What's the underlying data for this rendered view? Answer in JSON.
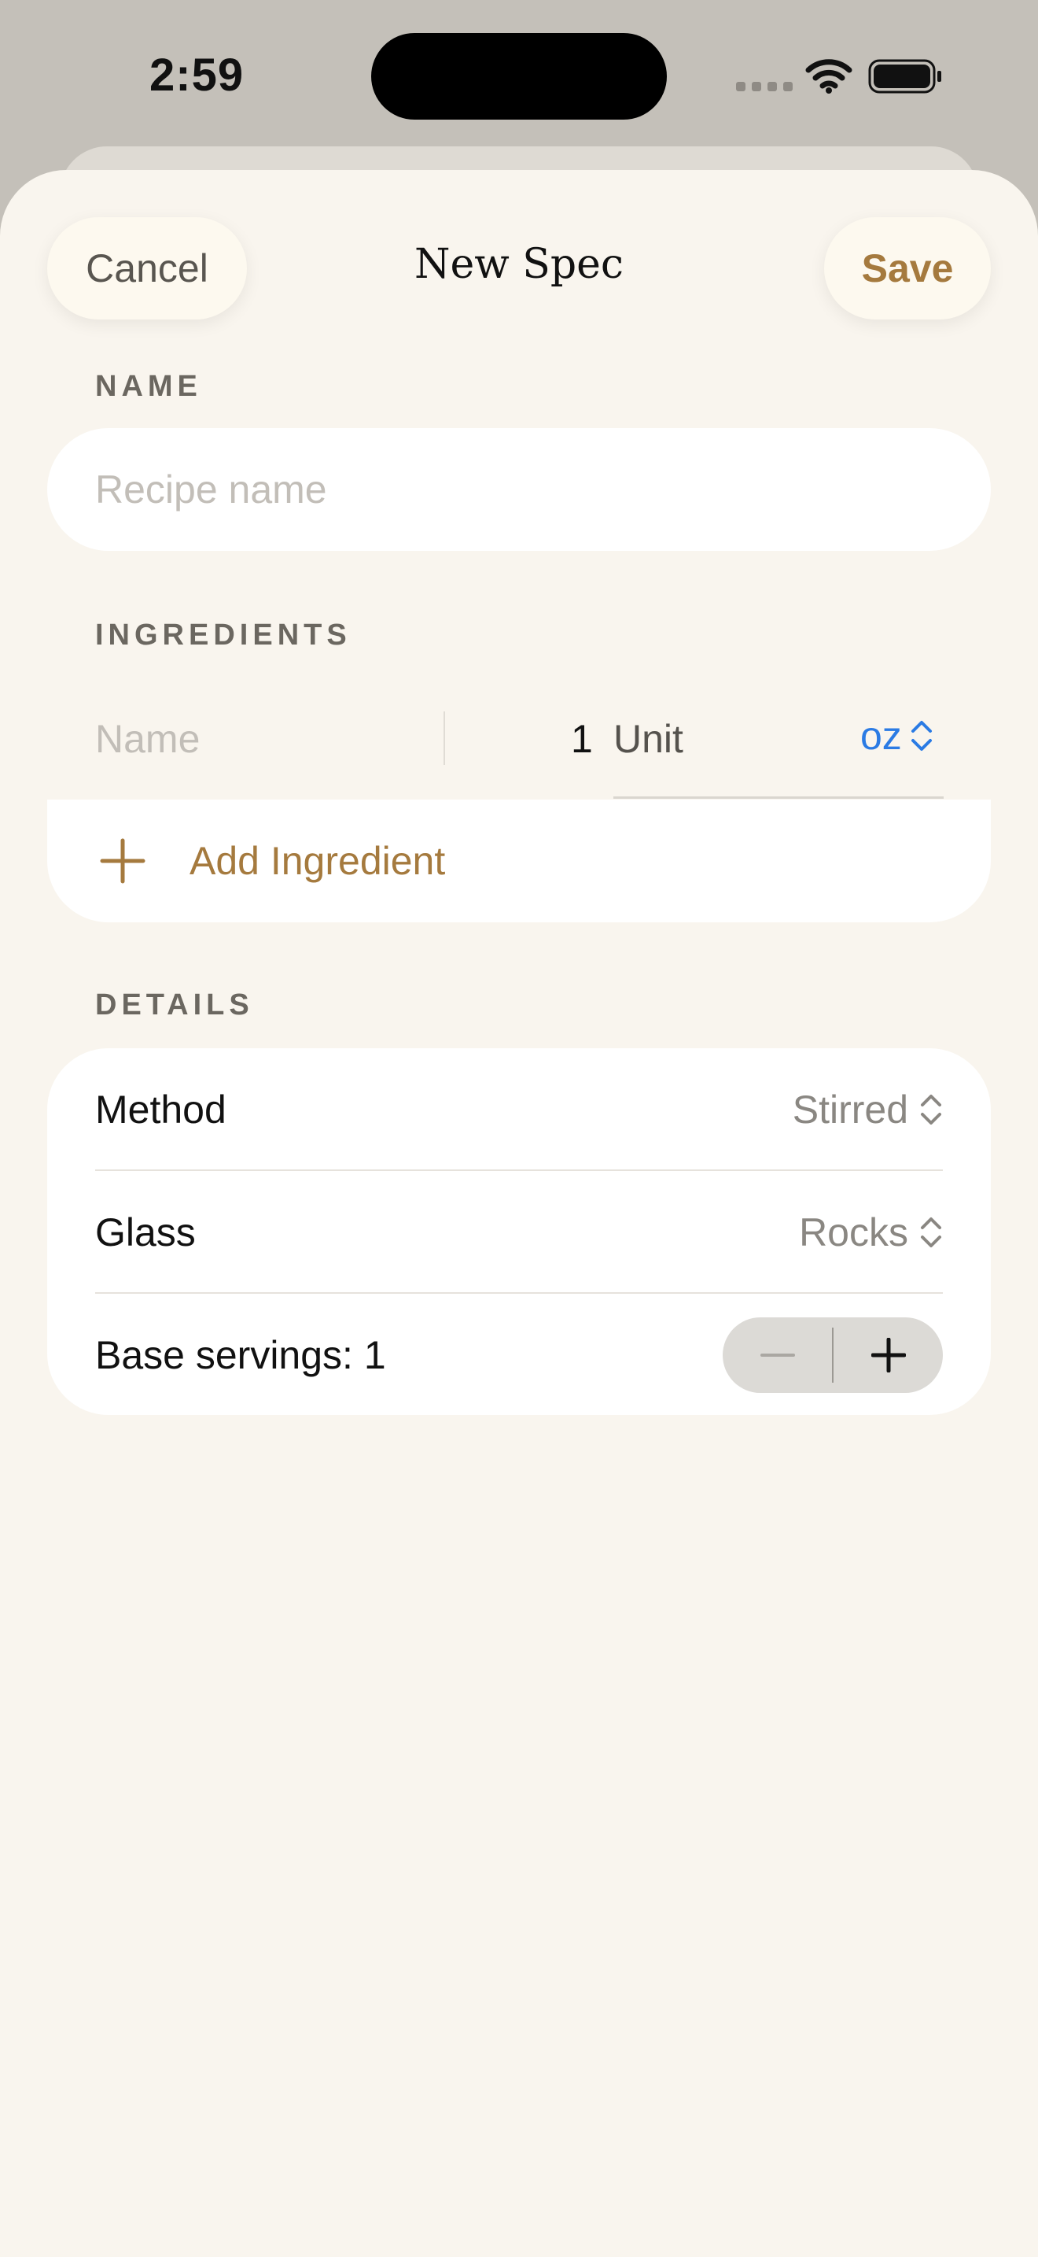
{
  "status_bar": {
    "time": "2:59"
  },
  "nav": {
    "cancel_label": "Cancel",
    "title": "New Spec",
    "save_label": "Save"
  },
  "name_section": {
    "header": "NAME",
    "placeholder": "Recipe name"
  },
  "ingredients_section": {
    "header": "INGREDIENTS",
    "row": {
      "name_placeholder": "Name",
      "amount": "1",
      "unit_label": "Unit",
      "unit_value": "oz"
    },
    "add_label": "Add Ingredient"
  },
  "details_section": {
    "header": "DETAILS",
    "method_label": "Method",
    "method_value": "Stirred",
    "glass_label": "Glass",
    "glass_value": "Rocks",
    "servings_label": "Base servings: 1"
  },
  "colors": {
    "accent": "#a57a3e",
    "link_blue": "#2b7be4",
    "sheet_background": "#f9f5ee",
    "backdrop": "#c4c0b9"
  },
  "icons": {
    "status": [
      "signal-icon",
      "wifi-icon",
      "battery-icon"
    ],
    "unit_picker": "chevron-up-down-icon",
    "add": "plus-icon",
    "stepper": [
      "minus-icon",
      "plus-icon"
    ]
  }
}
